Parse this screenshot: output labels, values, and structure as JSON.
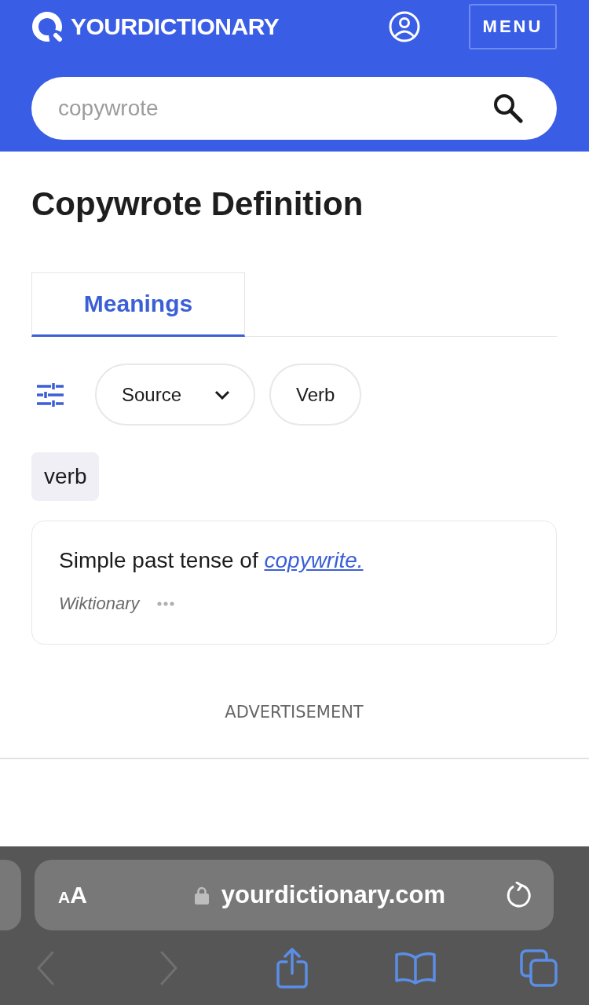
{
  "header": {
    "logo": "YOURDICTIONARY",
    "menu": "MENU"
  },
  "search": {
    "placeholder": "copywrote"
  },
  "title": "Copywrote Definition",
  "tabs": [
    {
      "label": "Meanings",
      "selected": true
    }
  ],
  "filters": [
    {
      "kind": "dropdown",
      "label": "Source"
    },
    {
      "kind": "chip",
      "label": "Verb"
    }
  ],
  "part_of_speech": "verb",
  "definitions": [
    {
      "text": "Simple past tense of",
      "link": "copywrite.",
      "source": "Wiktionary"
    }
  ],
  "advertisement": "ADVERTISEMENT",
  "browser": {
    "text_size": "AA",
    "url": "yourdictionary.com",
    "toolbar": [
      {
        "kind": "back",
        "disabled": true
      },
      {
        "kind": "forward",
        "disabled": true
      },
      {
        "kind": "share",
        "disabled": false
      },
      {
        "kind": "bookmarks",
        "disabled": false
      },
      {
        "kind": "tabs",
        "disabled": false
      }
    ]
  }
}
